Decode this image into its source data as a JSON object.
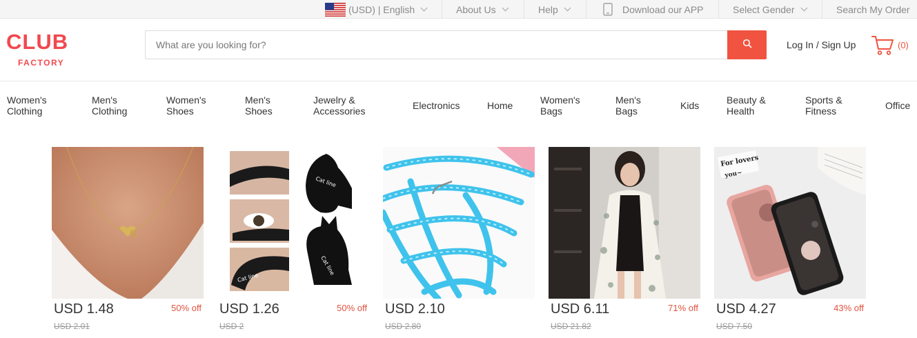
{
  "topbar": {
    "currency_lang": "(USD) | English",
    "about": "About Us",
    "help": "Help",
    "download": "Download our APP",
    "gender": "Select Gender",
    "search_order": "Search My Order"
  },
  "header": {
    "logo_top": "CLUB",
    "logo_bottom": "FACTORY",
    "search_placeholder": "What are you looking for?",
    "login": "Log In / Sign Up",
    "cart_count": "(0)"
  },
  "nav": {
    "items": [
      {
        "label": "Women's Clothing"
      },
      {
        "label": "Men's Clothing"
      },
      {
        "label": "Women's Shoes"
      },
      {
        "label": "Men's Shoes"
      },
      {
        "label": "Jewelry & Accessories"
      },
      {
        "label": "Electronics"
      },
      {
        "label": "Home"
      },
      {
        "label": "Women's Bags"
      },
      {
        "label": "Men's Bags"
      },
      {
        "label": "Kids"
      },
      {
        "label": "Beauty & Health"
      },
      {
        "label": "Sports & Fitness"
      },
      {
        "label": "Office"
      }
    ]
  },
  "products": [
    {
      "price": "USD 1.48",
      "discount": "50% off",
      "original": "USD 2.01"
    },
    {
      "price": "USD 1.26",
      "discount": "50% off",
      "original": "USD 2"
    },
    {
      "price": "USD 2.10",
      "discount": "",
      "original": "USD 2.80"
    },
    {
      "price": "USD 6.11",
      "discount": "71% off",
      "original": "USD 21.82"
    },
    {
      "price": "USD 4.27",
      "discount": "43% off",
      "original": "USD 7.50"
    }
  ],
  "colors": {
    "accent": "#f0533f",
    "logo": "#f0494f"
  }
}
